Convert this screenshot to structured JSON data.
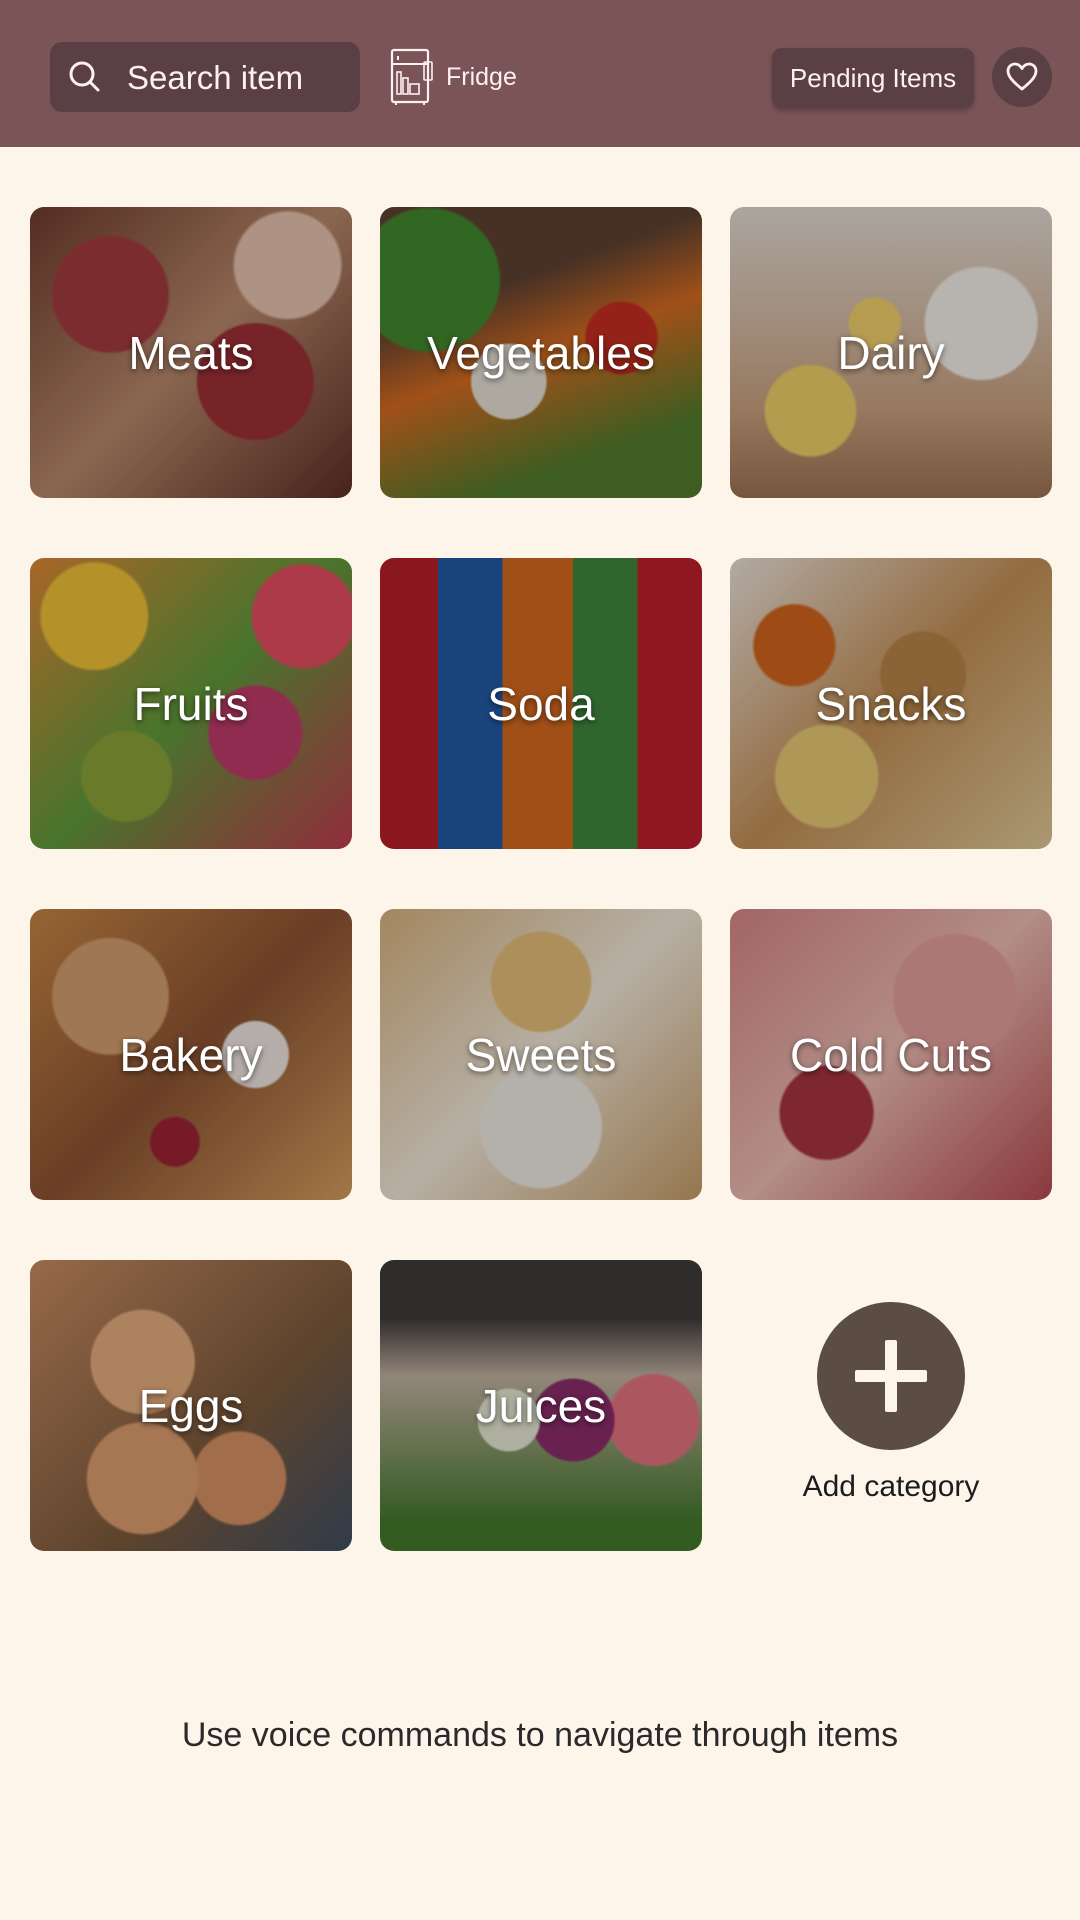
{
  "header": {
    "search_label": "Search item",
    "fridge_label": "Fridge",
    "pending_label": "Pending Items",
    "background_color": "#7b5458"
  },
  "categories": [
    {
      "name": "Meats",
      "image": "meats"
    },
    {
      "name": "Vegetables",
      "image": "vegetables"
    },
    {
      "name": "Dairy",
      "image": "dairy"
    },
    {
      "name": "Fruits",
      "image": "fruits"
    },
    {
      "name": "Soda",
      "image": "soda"
    },
    {
      "name": "Snacks",
      "image": "snacks"
    },
    {
      "name": "Bakery",
      "image": "bakery"
    },
    {
      "name": "Sweets",
      "image": "sweets"
    },
    {
      "name": "Cold Cuts",
      "image": "cold-cuts"
    },
    {
      "name": "Eggs",
      "image": "eggs"
    },
    {
      "name": "Juices",
      "image": "juices"
    }
  ],
  "add_category": {
    "label": "Add category",
    "icon": "plus-icon"
  },
  "footer": {
    "voice_hint": "Use voice commands to navigate through items"
  },
  "colors": {
    "page_background": "#fdf5ea",
    "button_dark": "#5a4044",
    "add_button": "#5b4c44"
  }
}
